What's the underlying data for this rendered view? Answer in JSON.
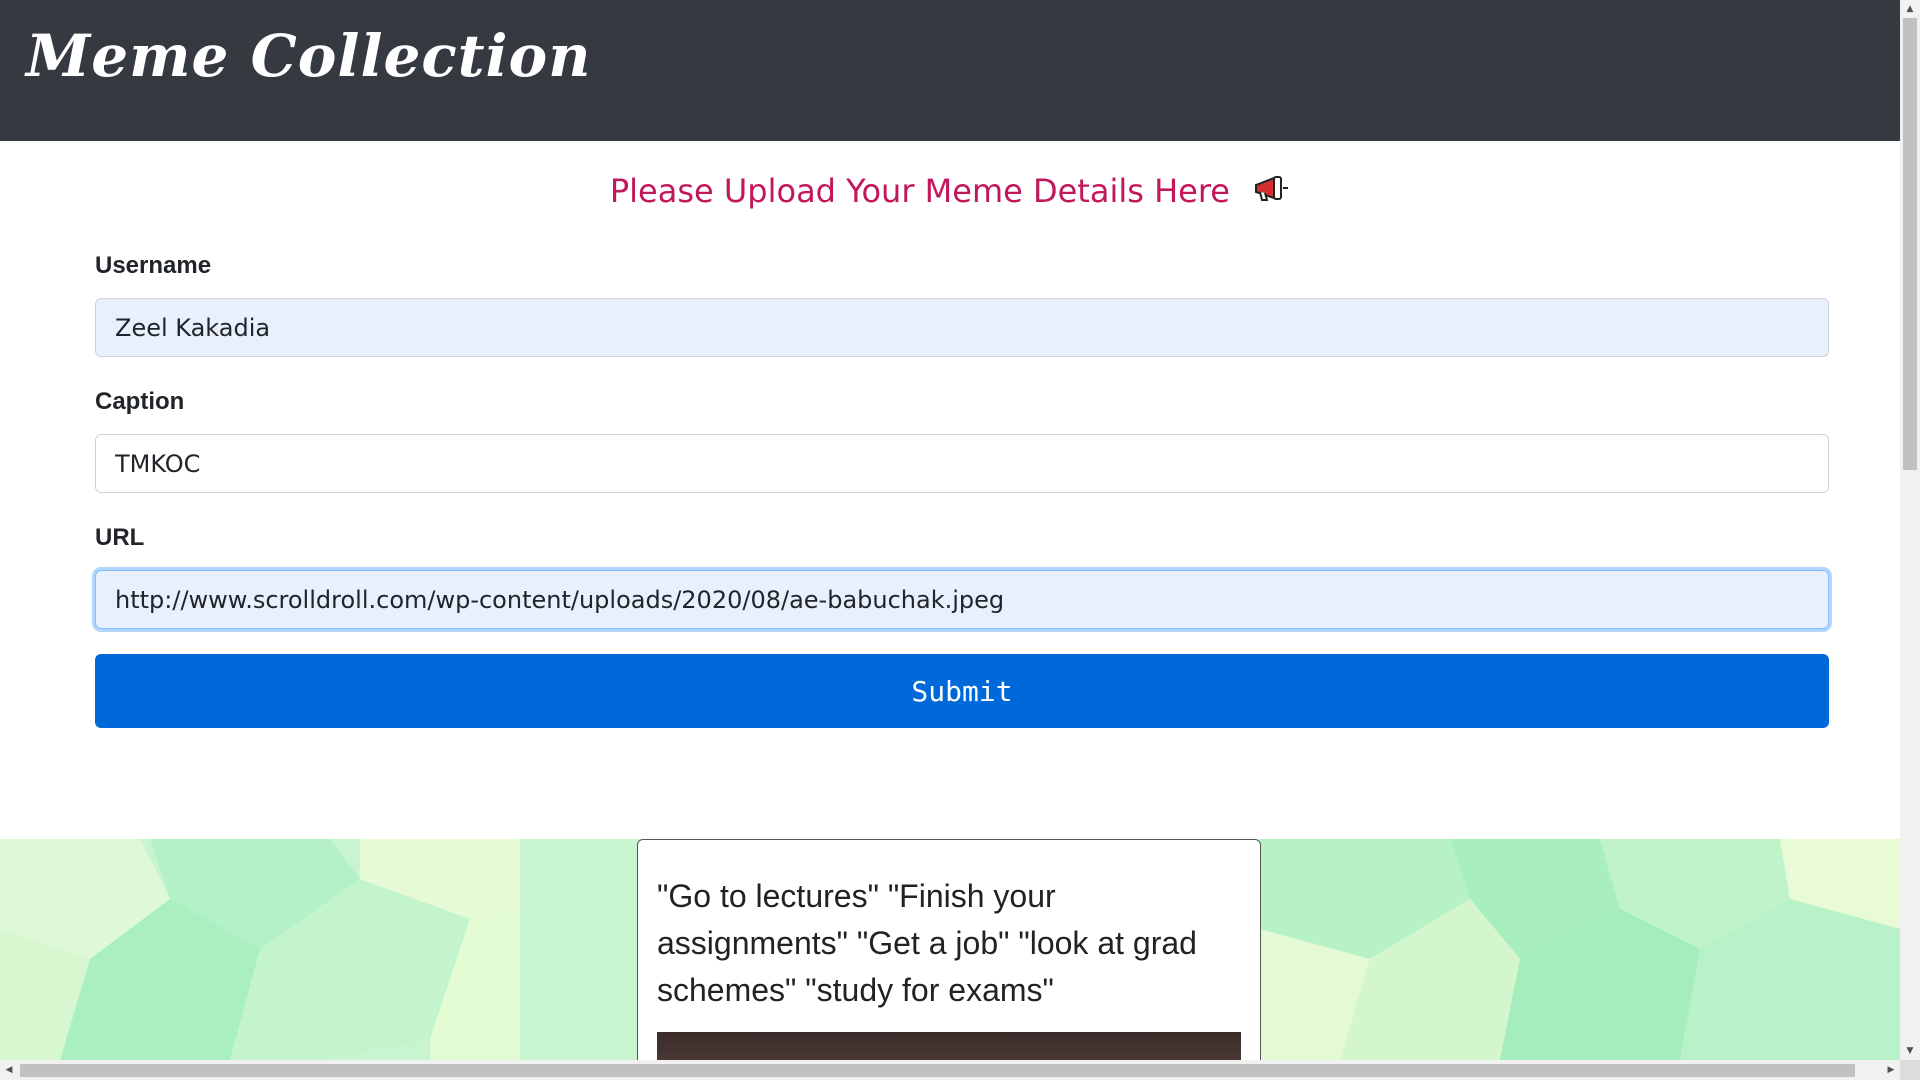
{
  "navbar": {
    "brand": "Meme Collection"
  },
  "form": {
    "heading": "Please Upload Your Meme Details Here",
    "heading_icon": "megaphone-icon",
    "username": {
      "label": "Username",
      "value": "Zeel Kakadia"
    },
    "caption": {
      "label": "Caption",
      "value": "TMKOC"
    },
    "url": {
      "label": "URL",
      "value": "http://www.scrolldroll.com/wp-content/uploads/2020/08/ae-babuchak.jpeg"
    },
    "submit_label": "Submit"
  },
  "meme_card": {
    "text": "\"Go to lectures\" \"Finish your assignments\" \"Get a job\" \"look at grad schemes\" \"study for exams\""
  },
  "colors": {
    "navbar_bg": "#343a40",
    "heading": "#c2185b",
    "submit_bg": "#0069d9",
    "autofill_bg": "#e8f0fe"
  }
}
